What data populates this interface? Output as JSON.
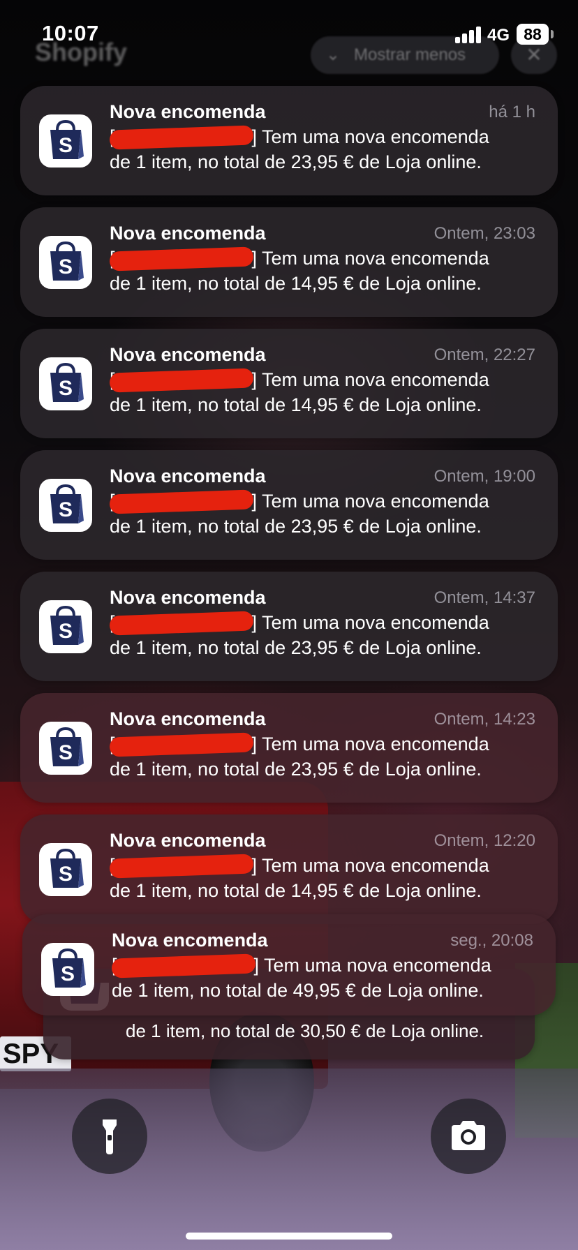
{
  "status_bar": {
    "time": "10:07",
    "network": "4G",
    "battery": "88"
  },
  "group_header": {
    "app_name": "Shopify",
    "show_less_label": "Mostrar menos",
    "close_symbol": "✕"
  },
  "colors": {
    "redaction": "#e5220e",
    "shopify_icon_bg": "#ffffff",
    "shopify_bag": "#1f2a5a"
  },
  "icons": {
    "app_icon": "shopify-bag-icon",
    "flashlight": "flashlight-icon",
    "camera": "camera-icon"
  },
  "notifications": [
    {
      "title": "Nova encomenda",
      "time": "há 1 h",
      "prefix": "[",
      "suffix": "] Tem uma nova encomenda",
      "body": "de 1 item, no total de 23,95 € de Loja online."
    },
    {
      "title": "Nova encomenda",
      "time": "Ontem, 23:03",
      "prefix": "[",
      "suffix": "] Tem uma nova encomenda",
      "body": "de 1 item, no total de 14,95 € de Loja online."
    },
    {
      "title": "Nova encomenda",
      "time": "Ontem, 22:27",
      "prefix": "[",
      "suffix": "] Tem uma nova encomenda",
      "body": "de 1 item, no total de 14,95 € de Loja online."
    },
    {
      "title": "Nova encomenda",
      "time": "Ontem, 19:00",
      "prefix": "[",
      "suffix": "] Tem uma nova encomenda",
      "body": "de 1 item, no total de 23,95 € de Loja online."
    },
    {
      "title": "Nova encomenda",
      "time": "Ontem, 14:37",
      "prefix": "[",
      "suffix": "] Tem uma nova encomenda",
      "body": "de 1 item, no total de 23,95 € de Loja online."
    },
    {
      "title": "Nova encomenda",
      "time": "Ontem, 14:23",
      "prefix": "[",
      "suffix": "] Tem uma nova encomenda",
      "body": "de 1 item, no total de 23,95 € de Loja online."
    },
    {
      "title": "Nova encomenda",
      "time": "Ontem, 12:20",
      "prefix": "[",
      "suffix": "] Tem uma nova encomenda",
      "body": "de 1 item, no total de 14,95 € de Loja online."
    },
    {
      "title": "Nova encomenda",
      "time": "seg., 20:08",
      "prefix": "[",
      "suffix": "] Tem uma nova encomenda",
      "body": "de 1 item, no total de 49,95 € de Loja online."
    }
  ],
  "stacked_notification": {
    "body": "de 1 item, no total de 30,50 € de Loja online."
  },
  "wallpaper": {
    "plate_text": "SPY"
  }
}
